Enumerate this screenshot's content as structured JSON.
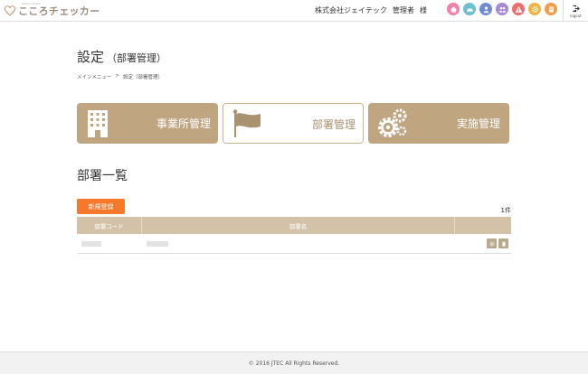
{
  "header": {
    "logo_sub": "Kokoro Check",
    "logo_text": "こころチェッカー",
    "company": "株式会社ジェイテック",
    "user": "管理者",
    "honorific": "様",
    "icons": [
      {
        "name": "home-icon",
        "color": "#ef82ad"
      },
      {
        "name": "cloud-icon",
        "color": "#6cc1ce"
      },
      {
        "name": "person-icon",
        "color": "#6f8bd6"
      },
      {
        "name": "people-icon",
        "color": "#a68ad8"
      },
      {
        "name": "warning-icon",
        "color": "#ef6f6f"
      },
      {
        "name": "gear-icon",
        "color": "#f2b244"
      },
      {
        "name": "book-icon",
        "color": "#f29b48"
      }
    ],
    "logout_label": "logout"
  },
  "page": {
    "title": "設定",
    "subtitle": "（部署管理）",
    "breadcrumb": [
      "メインメニュー",
      ">",
      "設定（部署管理）"
    ]
  },
  "tiles": [
    {
      "label": "事業所管理"
    },
    {
      "label": "部署管理"
    },
    {
      "label": "実施管理"
    }
  ],
  "list": {
    "title": "部署一覧",
    "new_button": "新規登録",
    "count": "1件",
    "columns": [
      "部署コード",
      "部署名",
      ""
    ]
  },
  "footer": {
    "copyright": "© 2016 JTEC All Rights Reserved."
  },
  "colors": {
    "accent": "#bfa680",
    "primary_button": "#f6782a",
    "table_header": "#d4c2a8"
  }
}
